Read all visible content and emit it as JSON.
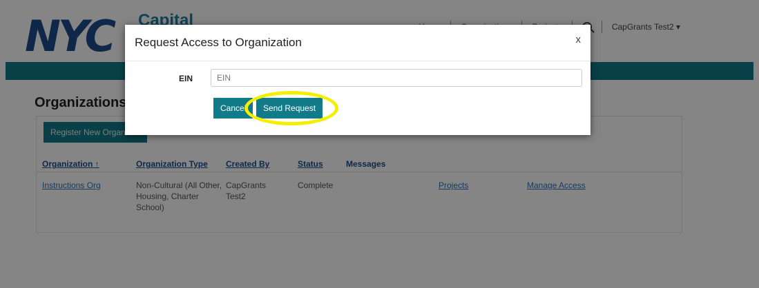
{
  "header": {
    "logo_text": "NYC",
    "brand_text": "Capital",
    "nav_items": [
      "Home",
      "Organizations",
      "Projects"
    ],
    "user_menu": "CapGrants Test2 ▾"
  },
  "main": {
    "title": "Organizations",
    "register_button": "Register New Organization",
    "columns": [
      "Organization ↑",
      "Organization Type",
      "Created By",
      "Status",
      "Messages"
    ],
    "row": {
      "organization": "Instructions Org",
      "type_lines": [
        "Non-Cultural (All Other,",
        "Housing, Charter",
        "School)"
      ],
      "created_by_lines": [
        "CapGrants",
        "Test2"
      ],
      "status": "Complete",
      "projects_link": "Projects",
      "manage_link": "Manage Access"
    }
  },
  "modal": {
    "title": "Request Access to Organization",
    "close": "x",
    "ein_label": "EIN",
    "ein_placeholder": "EIN",
    "cancel": "Cancel",
    "send": "Send Request"
  },
  "colors": {
    "teal": "#127b8a",
    "highlight": "#f2f000",
    "link": "#2a70b8"
  }
}
